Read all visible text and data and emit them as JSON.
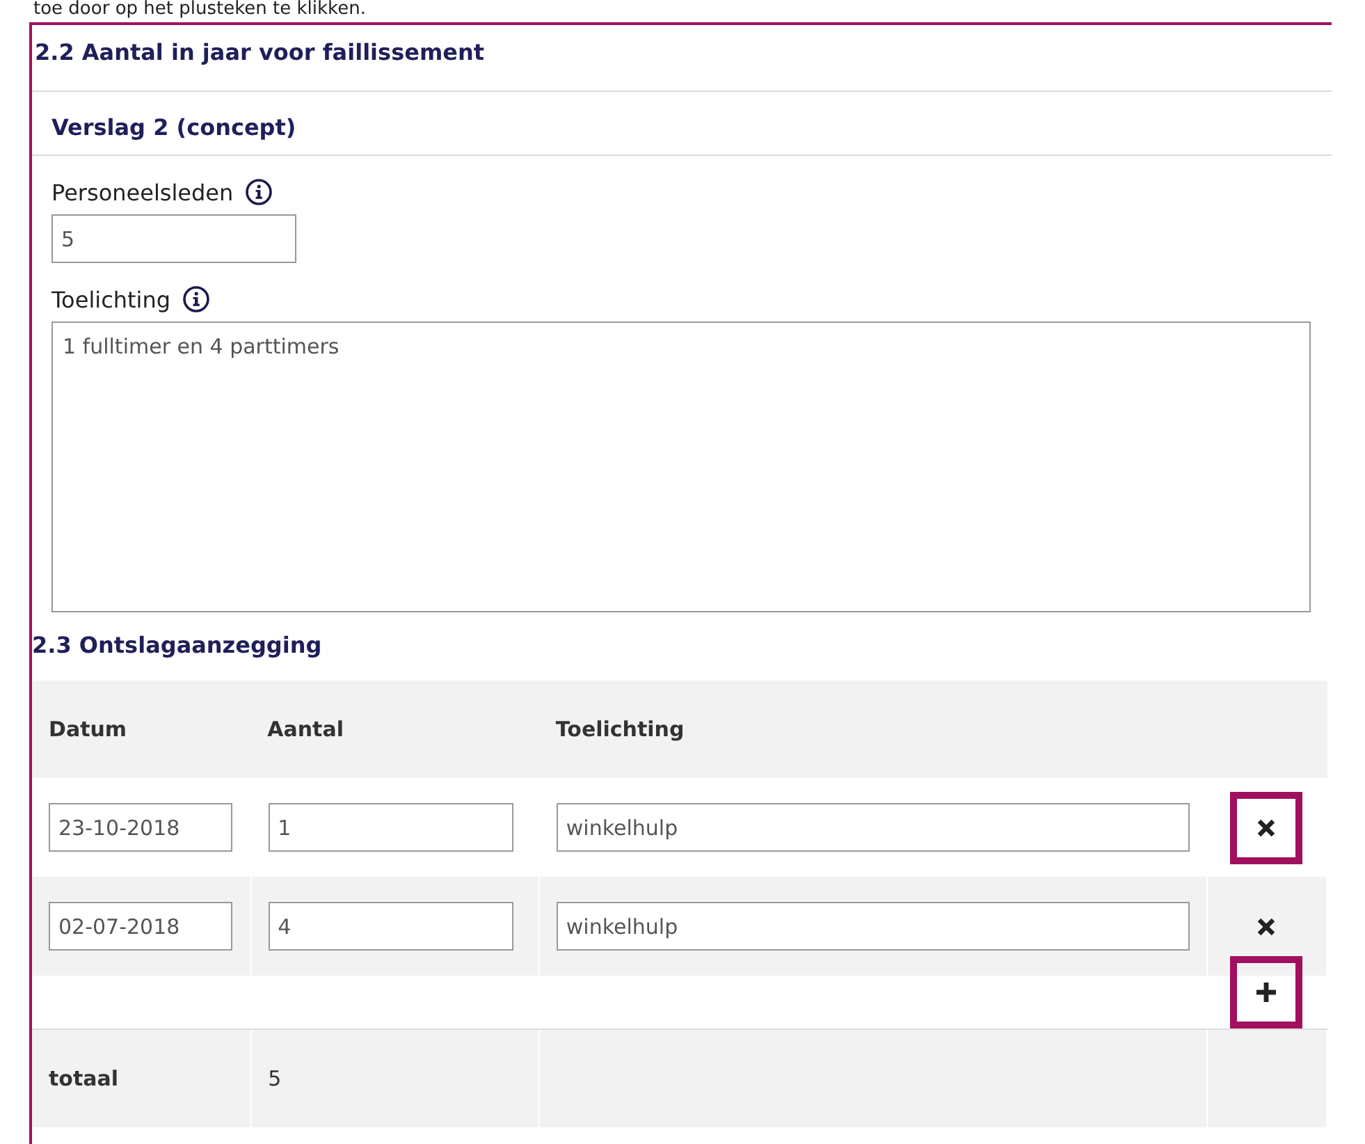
{
  "intro_text": "toe door op het plusteken te klikken.",
  "section_2_2": {
    "title": "2.2 Aantal in jaar voor faillissement",
    "subtitle": "Verslag 2 (concept)",
    "fields": [
      {
        "kind": "input",
        "label": "Personeelsleden",
        "value": "5"
      },
      {
        "kind": "textarea",
        "label": "Toelichting",
        "value": "1 fulltimer en 4 parttimers"
      }
    ]
  },
  "section_2_3": {
    "title": "2.3 Ontslagaanzegging",
    "columns": [
      "Datum",
      "Aantal",
      "Toelichting"
    ],
    "rows": [
      {
        "datum": "23-10-2018",
        "aantal": "1",
        "toelichting": "winkelhulp",
        "delete_highlighted": true
      },
      {
        "datum": "02-07-2018",
        "aantal": "4",
        "toelichting": "winkelhulp",
        "delete_highlighted": false
      }
    ],
    "add_highlighted": true,
    "total": {
      "label": "totaal",
      "value": "5"
    }
  }
}
